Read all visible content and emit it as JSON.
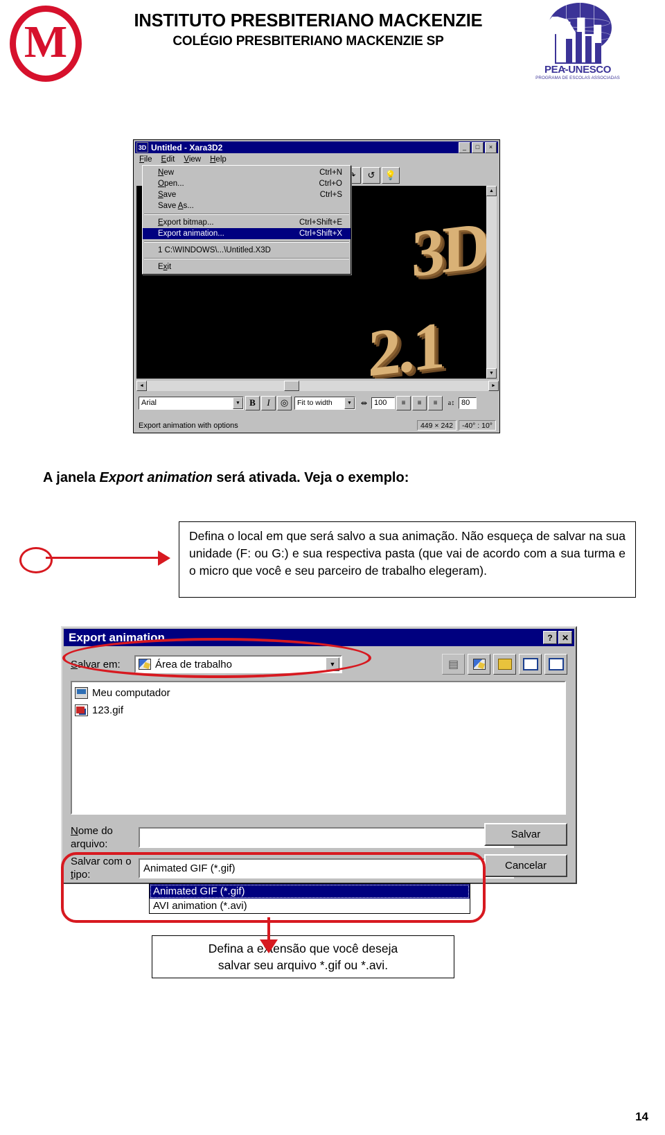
{
  "header": {
    "institute": "INSTITUTO PRESBITERIANO MACKENZIE",
    "school": "COLÉGIO PRESBITERIANO MACKENZIE   SP",
    "logo_letter": "M",
    "unesco_label": "PEA-UNESCO",
    "unesco_sublabel": "PROGRAMA DE ESCOLAS ASSOCIADAS",
    "logo_color": "#d6112c",
    "unesco_color": "#3b3397"
  },
  "xara": {
    "title": "Untitled - Xara3D2",
    "title_icon": "3D",
    "window_buttons": [
      "_",
      "□",
      "×"
    ],
    "menus": [
      {
        "label": "File",
        "mnemonic": "F",
        "active": true
      },
      {
        "label": "Edit",
        "mnemonic": "E",
        "active": false
      },
      {
        "label": "View",
        "mnemonic": "V",
        "active": false
      },
      {
        "label": "Help",
        "mnemonic": "H",
        "active": false
      }
    ],
    "file_menu": [
      {
        "label": "New",
        "mnemonic": "N",
        "accel": "Ctrl+N",
        "selected": false,
        "sep_after": false
      },
      {
        "label": "Open...",
        "mnemonic": "O",
        "accel": "Ctrl+O",
        "selected": false,
        "sep_after": false
      },
      {
        "label": "Save",
        "mnemonic": "S",
        "accel": "Ctrl+S",
        "selected": false,
        "sep_after": false
      },
      {
        "label": "Save As...",
        "mnemonic": "A",
        "accel": "",
        "selected": false,
        "sep_after": true
      },
      {
        "label": "Export bitmap...",
        "mnemonic": "E",
        "accel": "Ctrl+Shift+E",
        "selected": false,
        "sep_after": false
      },
      {
        "label": "Export animation...",
        "mnemonic": "",
        "accel": "Ctrl+Shift+X",
        "selected": true,
        "sep_after": true
      },
      {
        "label": "1 C:\\WINDOWS\\...\\Untitled.X3D",
        "mnemonic": "1",
        "accel": "",
        "selected": false,
        "sep_after": true
      },
      {
        "label": "Exit",
        "mnemonic": "x",
        "accel": "",
        "selected": false,
        "sep_after": false
      }
    ],
    "canvas_text_top": "3D",
    "canvas_text_bottom": "2.1",
    "toolbar_icons": [
      "redo-icon",
      "undo-icon",
      "light-bulb-icon"
    ],
    "textbar": {
      "font_name": "Arial",
      "bold_label": "B",
      "italic_label": "I",
      "outline_label": "◎",
      "fit_mode": "Fit to width",
      "tracking_value": "100",
      "line_spacing_value": "80",
      "align_icons": [
        "align-left-icon",
        "align-center-icon",
        "align-right-icon"
      ]
    },
    "status": {
      "text": "Export animation with options",
      "size": "449 × 242",
      "angles": "-40° : 10°"
    }
  },
  "instruction": {
    "heading_before": "A janela ",
    "heading_italic": "Export animation",
    "heading_after": " será ativada. Veja o exemplo:",
    "note": "Defina o local em que será salvo a sua animação. Não esqueça de salvar na sua unidade (F: ou G:) e sua respectiva pasta (que vai de acordo com a sua turma e o micro que você e seu parceiro de trabalho elegeram)."
  },
  "export_dialog": {
    "title": "Export animation",
    "help_button": "?",
    "close_button": "✕",
    "save_in_label_pre": "S",
    "save_in_label_post": "alvar em:",
    "save_in_value": "Área de trabalho",
    "toolbar_icons": [
      "up-one-level-icon",
      "create-new-folder-icon",
      "new-folder-icon",
      "list-view-icon",
      "details-view-icon"
    ],
    "files": [
      {
        "name": "Meu computador",
        "icon": "computer-icon"
      },
      {
        "name": "123.gif",
        "icon": "gif-file-icon"
      }
    ],
    "file_name_label_line1_pre": "N",
    "file_name_label_line1_post": "ome do",
    "file_name_label_line2": "arquivo:",
    "file_name_value": "",
    "file_type_label_line1": "Salvar com o",
    "file_type_label_line2_pre": "t",
    "file_type_label_line2_post": "ipo:",
    "file_type_value": "Animated GIF (*.gif)",
    "file_type_options": [
      {
        "label": "Animated GIF (*.gif)",
        "selected": true
      },
      {
        "label": "AVI animation (*.avi)",
        "selected": false
      }
    ],
    "save_button": "Salvar",
    "cancel_button": "Cancelar"
  },
  "bottom_note": {
    "line1": "Defina a extensão que você deseja",
    "line2": "salvar seu arquivo *.gif ou *.avi."
  },
  "annotation_color": "#d71920",
  "page_number": "14"
}
